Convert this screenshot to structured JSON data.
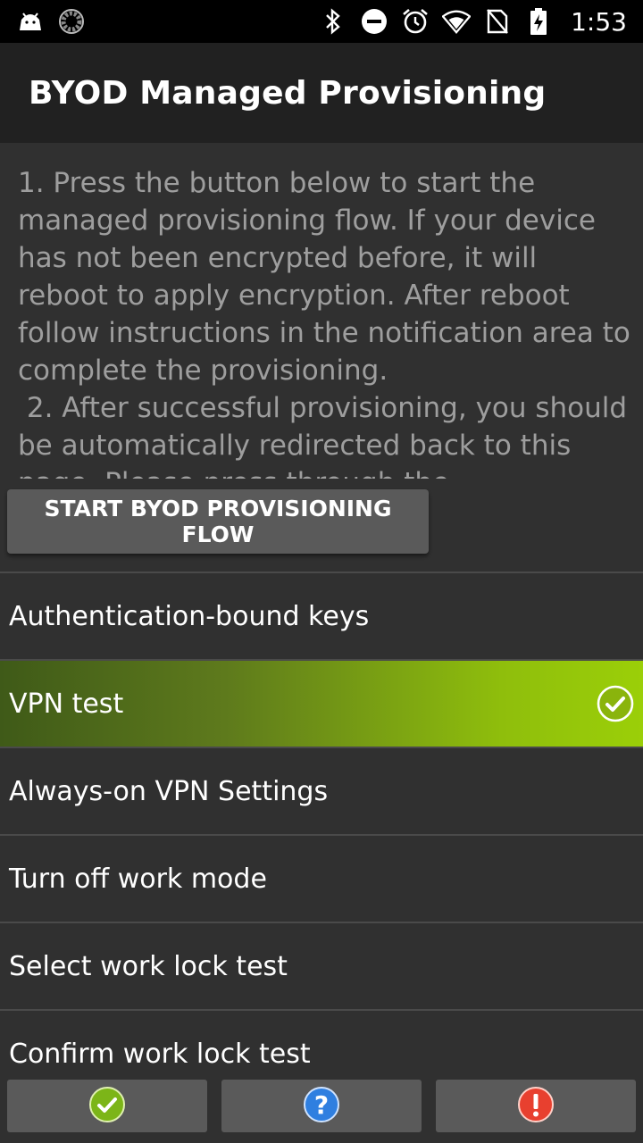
{
  "status_bar": {
    "time": "1:53",
    "left_icons": [
      "android-notification-icon",
      "sync-progress-icon"
    ],
    "right_icons": [
      "bluetooth-icon",
      "do-not-disturb-icon",
      "alarm-icon",
      "wifi-icon",
      "no-sim-icon",
      "battery-charging-icon"
    ]
  },
  "app_bar": {
    "title": "BYOD Managed Provisioning"
  },
  "instructions": "1. Press the button below to start the managed provisioning flow. If your device has not been encrypted before, it will reboot to apply encryption. After reboot follow instructions in the notification area to complete the provisioning.\n 2. After successful provisioning, you should be automatically redirected back to this page. Please press through the",
  "start_button": "START BYOD PROVISIONING FLOW",
  "tests": [
    {
      "label": "Authentication-bound keys",
      "status": "not-run"
    },
    {
      "label": "VPN test",
      "status": "passed"
    },
    {
      "label": "Always-on VPN Settings",
      "status": "not-run"
    },
    {
      "label": "Turn off work mode",
      "status": "not-run"
    },
    {
      "label": "Select work lock test",
      "status": "not-run"
    },
    {
      "label": "Confirm work lock test",
      "status": "not-run"
    }
  ],
  "bottom_buttons": [
    {
      "name": "pass-button",
      "icon": "pass-check-icon",
      "color": "#8bc34a"
    },
    {
      "name": "info-button",
      "icon": "help-question-icon",
      "color": "#2196f3"
    },
    {
      "name": "fail-button",
      "icon": "fail-exclamation-icon",
      "color": "#f44336"
    }
  ],
  "colors": {
    "background": "#303030",
    "app_bar": "#212121",
    "status_bar": "#000000",
    "button": "#5a5a5a",
    "pass_highlight": "#9bcf08",
    "instruction_text": "#9e9e9e"
  }
}
